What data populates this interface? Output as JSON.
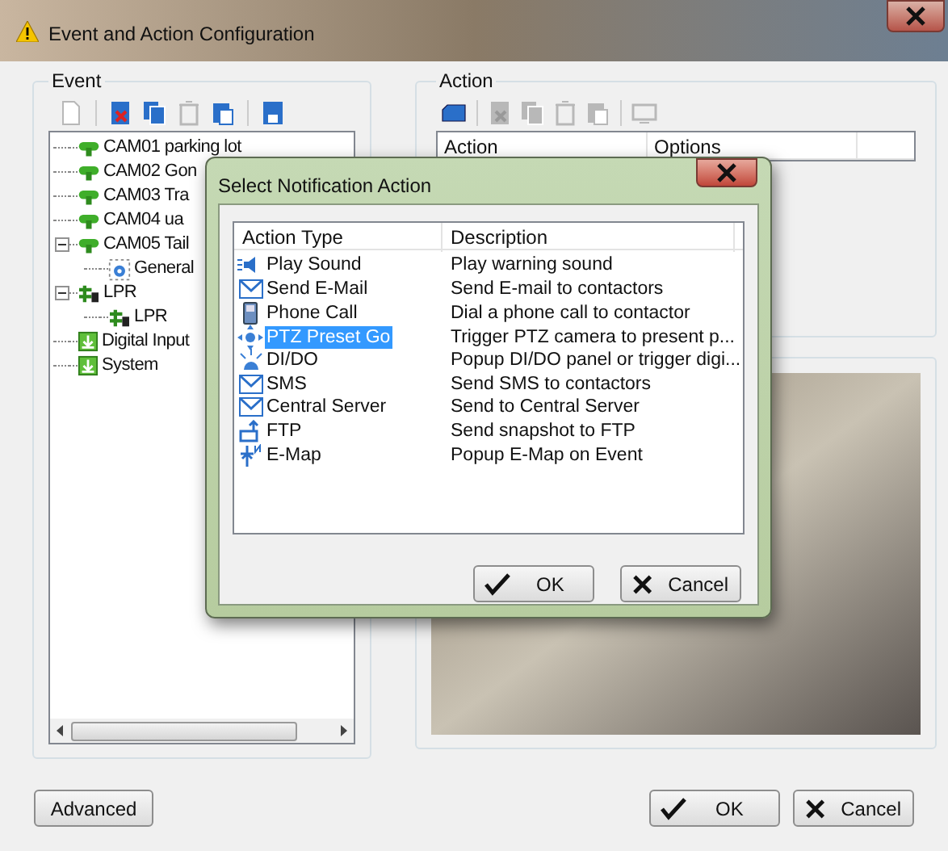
{
  "window": {
    "title": "Event and Action Configuration"
  },
  "event": {
    "title": "Event",
    "tools": [
      {
        "kind": "new",
        "disabled": true
      },
      {
        "kind": "delete",
        "disabled": false
      },
      {
        "kind": "copy",
        "disabled": false
      },
      {
        "kind": "trash",
        "disabled": true
      },
      {
        "kind": "paste",
        "disabled": false
      },
      {
        "kind": "save",
        "disabled": false
      }
    ],
    "tree": [
      {
        "kind": "camera",
        "label": "CAM01 parking lot"
      },
      {
        "kind": "camera",
        "label": "CAM02 Gon"
      },
      {
        "kind": "camera",
        "label": "CAM03 Tra"
      },
      {
        "kind": "camera",
        "label": "CAM04 ua"
      },
      {
        "kind": "camera",
        "label": "CAM05 Tail",
        "expanded": true,
        "children": [
          {
            "kind": "event",
            "label": "General"
          }
        ]
      },
      {
        "kind": "lpr",
        "label": "LPR",
        "expanded": true,
        "children": [
          {
            "kind": "lpr",
            "label": "LPR"
          }
        ]
      },
      {
        "kind": "input",
        "label": "Digital Input"
      },
      {
        "kind": "input",
        "label": "System"
      }
    ]
  },
  "action": {
    "title": "Action",
    "tools": [
      {
        "kind": "add",
        "disabled": false
      },
      {
        "kind": "delete",
        "disabled": true
      },
      {
        "kind": "copy",
        "disabled": true
      },
      {
        "kind": "trash",
        "disabled": true
      },
      {
        "kind": "paste",
        "disabled": true
      },
      {
        "kind": "test",
        "disabled": true
      }
    ],
    "columns": [
      "Action",
      "Options"
    ]
  },
  "buttons": {
    "advanced": "Advanced",
    "ok": "OK",
    "cancel": "Cancel"
  },
  "dialog": {
    "title": "Select Notification Action",
    "columns": [
      "Action Type",
      "Description"
    ],
    "rows": [
      {
        "kind": "sound",
        "type": "Play Sound",
        "description": "Play warning sound",
        "selected": false
      },
      {
        "kind": "email",
        "type": "Send E-Mail",
        "description": "Send E-mail to contactors",
        "selected": false
      },
      {
        "kind": "phone",
        "type": "Phone Call",
        "description": "Dial a phone call to contactor",
        "selected": false
      },
      {
        "kind": "ptz",
        "type": "PTZ Preset Go",
        "description": "Trigger PTZ camera to present p...",
        "selected": true
      },
      {
        "kind": "dido",
        "type": "DI/DO",
        "description": "Popup DI/DO panel or trigger digi...",
        "selected": false
      },
      {
        "kind": "email",
        "type": "SMS",
        "description": "Send SMS to contactors",
        "selected": false
      },
      {
        "kind": "email",
        "type": "Central Server",
        "description": "Send to Central Server",
        "selected": false
      },
      {
        "kind": "ftp",
        "type": "FTP",
        "description": "Send snapshot to FTP",
        "selected": false
      },
      {
        "kind": "emap",
        "type": "E-Map",
        "description": "Popup E-Map on Event",
        "selected": false
      }
    ],
    "ok": "OK",
    "cancel": "Cancel"
  }
}
